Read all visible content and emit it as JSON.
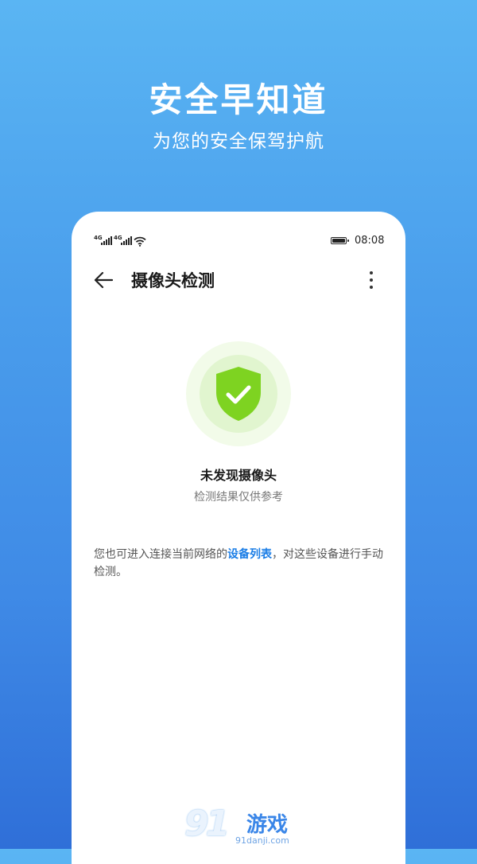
{
  "promo": {
    "title": "安全早知道",
    "subtitle": "为您的安全保驾护航"
  },
  "statusbar": {
    "network1": "4G",
    "network2": "4G",
    "time": "08:08"
  },
  "header": {
    "title": "摄像头检测"
  },
  "result": {
    "title": "未发现摄像头",
    "subtitle": "检测结果仅供参考"
  },
  "hint": {
    "text_before": "您也可进入连接当前网络的",
    "link_text": "设备列表",
    "text_after": "，对这些设备进行手动检测。"
  },
  "colors": {
    "accent": "#1a7de6",
    "shield_green": "#7ed321"
  },
  "watermark": {
    "logo": "91",
    "name": "游戏",
    "domain": "91danji.com"
  }
}
